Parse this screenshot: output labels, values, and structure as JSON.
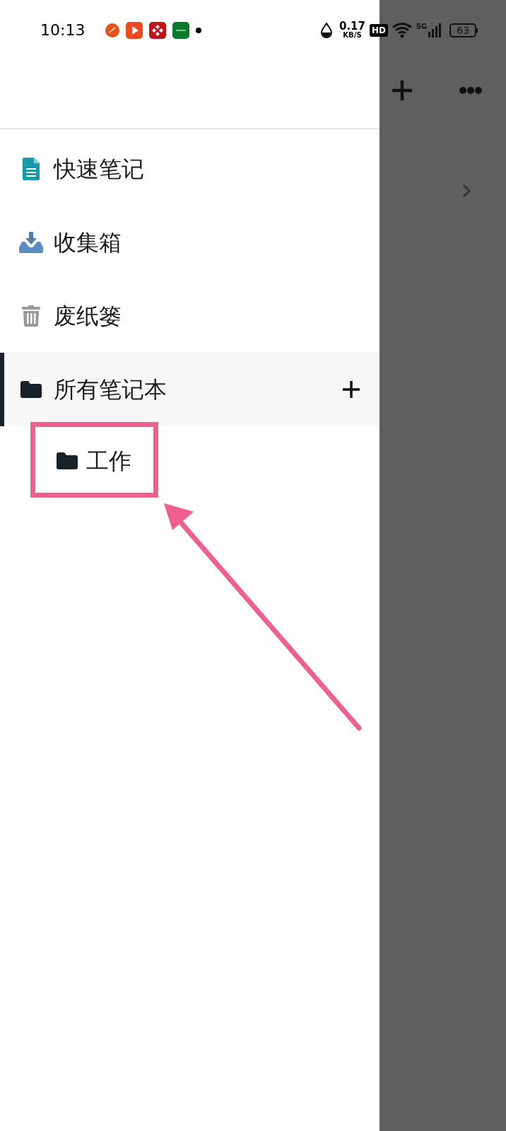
{
  "status_bar": {
    "time": "10:13",
    "speed_value": "0.17",
    "speed_unit": "KB/S",
    "hd_badge": "HD",
    "network": "5G",
    "battery": "63"
  },
  "drawer": {
    "items": [
      {
        "kind": "quick-note",
        "label": "快速笔记",
        "selected": false
      },
      {
        "kind": "inbox",
        "label": "收集箱",
        "selected": false
      },
      {
        "kind": "trash",
        "label": "废纸篓",
        "selected": false
      },
      {
        "kind": "notebooks",
        "label": "所有笔记本",
        "selected": true,
        "children": [
          {
            "label": "工作"
          }
        ]
      }
    ]
  }
}
